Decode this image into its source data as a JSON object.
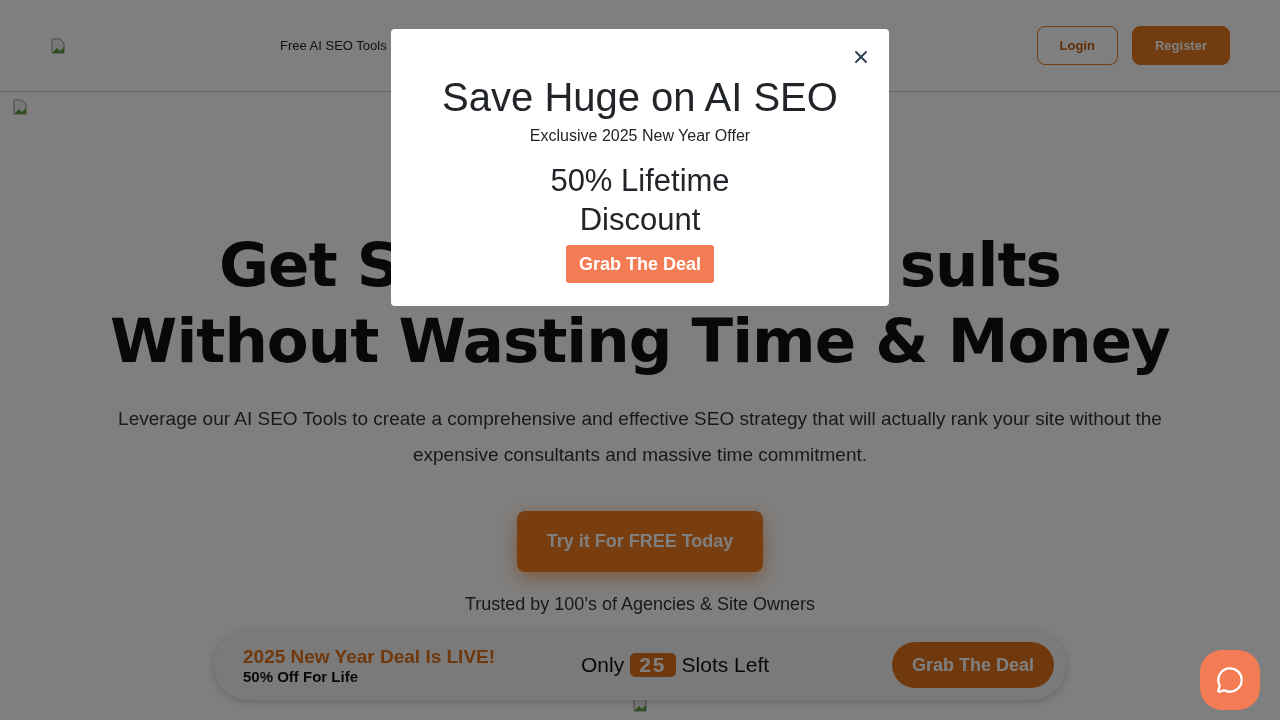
{
  "header": {
    "nav": [
      {
        "label": "Free AI SEO Tools"
      }
    ],
    "auth_buttons": [
      {
        "label": "Login",
        "kind": "outline"
      },
      {
        "label": "Register",
        "kind": "solid"
      }
    ]
  },
  "hero": {
    "headline_line_1_parts": [
      "Get S",
      "sults"
    ],
    "headline_line_2": "Without Wasting Time & Money",
    "subtitle": "Leverage our AI SEO Tools to create a comprehensive and effective SEO strategy that will actually rank your site without the expensive consultants and massive time commitment.",
    "cta": "Try it For FREE Today",
    "trust": "Trusted by 100’s of Agencies & Site Owners"
  },
  "deal_bar": {
    "title": "2025 New Year Deal Is LIVE!",
    "subtitle": "50% Off For Life",
    "slots_prefix": "Only",
    "slots_count": "25",
    "slots_suffix": "Slots Left",
    "button": "Grab The Deal"
  },
  "modal": {
    "open": true,
    "title": "Save Huge on AI SEO",
    "subtitle": "Exclusive 2025 New Year Offer",
    "offer": "50% Lifetime Discount",
    "button": "Grab The Deal"
  }
}
